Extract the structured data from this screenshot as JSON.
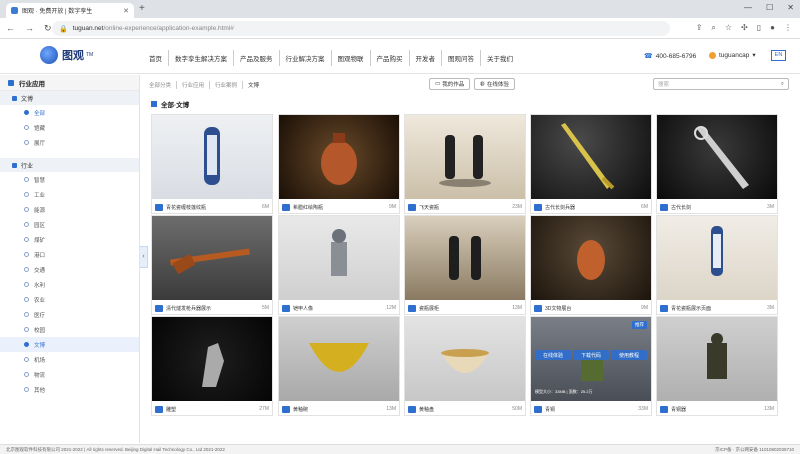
{
  "browser": {
    "tab_title": "图观 · 免费开放 | 数字孪生",
    "url_host": "tuguan.net",
    "url_path": "/online-experience/application-example.html#"
  },
  "header": {
    "logo_text": "图观",
    "logo_tm": "TM",
    "nav": [
      "首页",
      "数字孪生解决方案",
      "产品及服务",
      "行业解决方案",
      "图观物联",
      "产品购买",
      "开发者",
      "图观问答",
      "关于我们"
    ],
    "phone": "400-685-6796",
    "user": "tuguancap",
    "lang": "EN"
  },
  "sidebar": {
    "title": "行业应用",
    "groups": [
      {
        "label": "文博",
        "items": [
          {
            "label": "全部",
            "active": true
          },
          {
            "label": "馆藏",
            "active": false
          },
          {
            "label": "展厅",
            "active": false
          }
        ]
      },
      {
        "label": "行业",
        "items": [
          {
            "label": "智慧",
            "active": false
          },
          {
            "label": "工业",
            "active": false
          },
          {
            "label": "能源",
            "active": false
          },
          {
            "label": "园区",
            "active": false
          },
          {
            "label": "煤矿",
            "active": false
          },
          {
            "label": "港口",
            "active": false
          },
          {
            "label": "交通",
            "active": false
          },
          {
            "label": "水利",
            "active": false
          },
          {
            "label": "农业",
            "active": false
          },
          {
            "label": "医疗",
            "active": false
          },
          {
            "label": "校园",
            "active": false
          },
          {
            "label": "文博",
            "active": true,
            "selected": true
          },
          {
            "label": "机场",
            "active": false
          },
          {
            "label": "物流",
            "active": false
          },
          {
            "label": "其他",
            "active": false
          }
        ]
      }
    ]
  },
  "breadcrumb": [
    "全部分类",
    "行业应用",
    "行业案例",
    "文博"
  ],
  "toolbar": {
    "btn1": "我的作品",
    "btn2": "在线体验",
    "search_placeholder": "搜索"
  },
  "section_title": "全部·文博",
  "cards": [
    {
      "name": "青花瓷缠枝莲纹瓶",
      "size": "6M"
    },
    {
      "name": "希腊红绘陶瓶",
      "size": "9M"
    },
    {
      "name": "飞天瓷瓶",
      "size": "23M"
    },
    {
      "name": "古代长剑兵器",
      "size": "6M"
    },
    {
      "name": "古代长剑",
      "size": "3M"
    },
    {
      "name": "清代燧发枪兵器展示",
      "size": "5M"
    },
    {
      "name": "铠甲人像",
      "size": "12M"
    },
    {
      "name": "瓷瓶展柜",
      "size": "13M"
    },
    {
      "name": "3D文物展台",
      "size": "9M"
    },
    {
      "name": "青花瓷瓶展示页面",
      "size": "3M"
    },
    {
      "name": "雕塑",
      "size": "27M"
    },
    {
      "name": "黄釉碗",
      "size": "13M"
    },
    {
      "name": "黄釉盘",
      "size": "50M"
    },
    {
      "name": "青铜",
      "size": "33M"
    },
    {
      "name": "青铜器",
      "size": "13M"
    }
  ],
  "hover_overlay": {
    "tag": "推荐",
    "btn1": "在线体验",
    "btn2": "下载代码",
    "btn3": "使用教程",
    "info": "模型大小：33MB | 面数：25.2万"
  },
  "footer": {
    "left": "北京图观软件科技有限公司 2021-2022 | All rights reserved. Beijing Digital Hail Technology Co., Ltd 2021-2022",
    "right": "京ICP备 · 京公网安备 11010802035710"
  }
}
